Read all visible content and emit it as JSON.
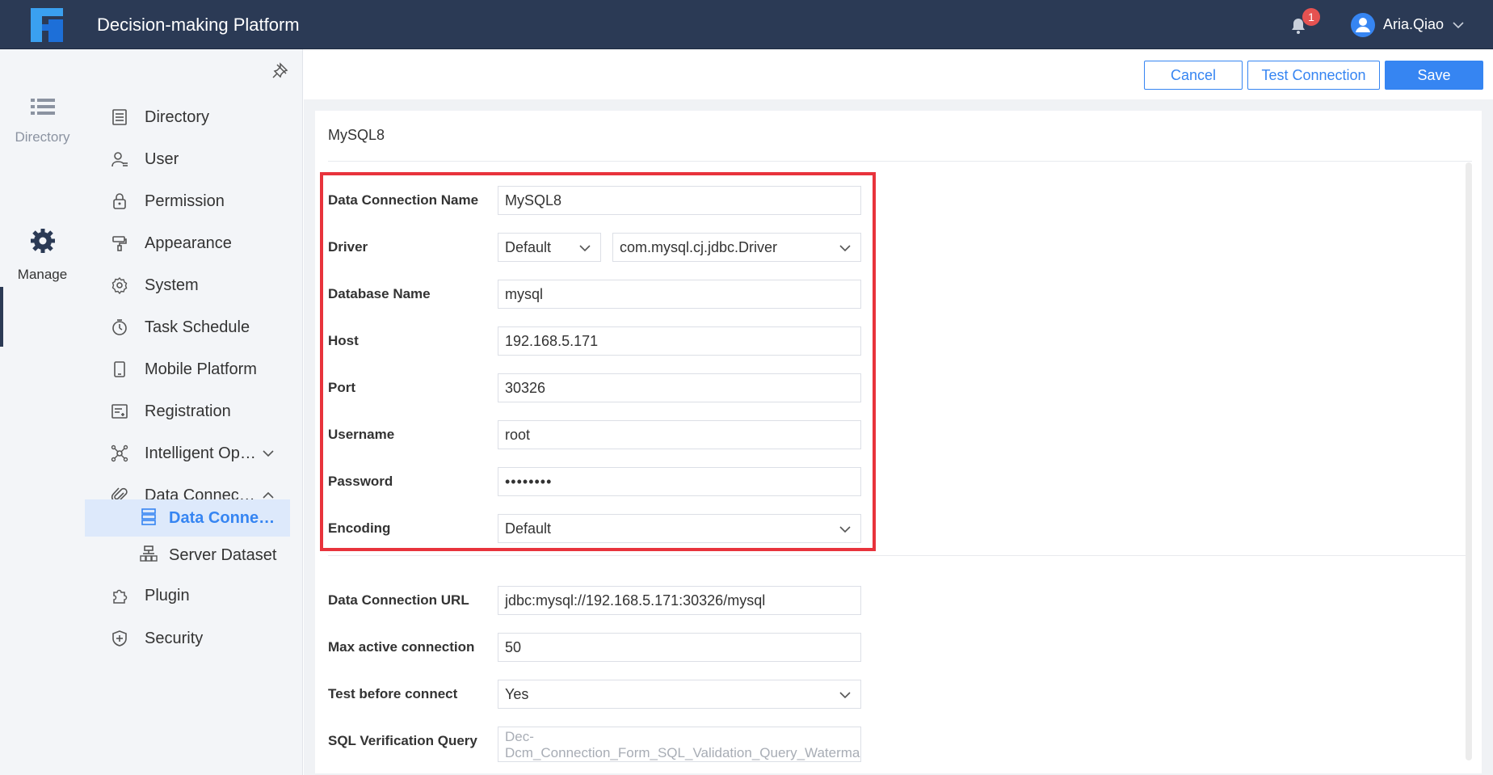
{
  "app": {
    "title": "Decision-making Platform",
    "notifications_count": "1",
    "user_name": "Aria.Qiao"
  },
  "rail": {
    "directory_label": "Directory",
    "manage_label": "Manage"
  },
  "nav": {
    "items": [
      {
        "label": "Directory"
      },
      {
        "label": "User"
      },
      {
        "label": "Permission"
      },
      {
        "label": "Appearance"
      },
      {
        "label": "System"
      },
      {
        "label": "Task Schedule"
      },
      {
        "label": "Mobile Platform"
      },
      {
        "label": "Registration"
      },
      {
        "label": "Intelligent Op…"
      },
      {
        "label": "Data Connec…"
      },
      {
        "label": "Plugin"
      },
      {
        "label": "Security"
      }
    ],
    "subitems": [
      {
        "label": "Data Conne…"
      },
      {
        "label": "Server Dataset"
      }
    ]
  },
  "actions": {
    "cancel": "Cancel",
    "test_connection": "Test Connection",
    "save": "Save"
  },
  "form": {
    "title": "MySQL8",
    "connection_name": {
      "label": "Data Connection Name",
      "value": "MySQL8"
    },
    "driver": {
      "label": "Driver",
      "type_value": "Default",
      "class_value": "com.mysql.cj.jdbc.Driver"
    },
    "database_name": {
      "label": "Database Name",
      "value": "mysql"
    },
    "host": {
      "label": "Host",
      "value": "192.168.5.171"
    },
    "port": {
      "label": "Port",
      "value": "30326"
    },
    "username": {
      "label": "Username",
      "value": "root"
    },
    "password": {
      "label": "Password",
      "value": "••••••••"
    },
    "encoding": {
      "label": "Encoding",
      "value": "Default"
    },
    "url": {
      "label": "Data Connection URL",
      "value": "jdbc:mysql://192.168.5.171:30326/mysql"
    },
    "max_active": {
      "label": "Max active connection",
      "value": "50"
    },
    "test_before_connect": {
      "label": "Test before connect",
      "value": "Yes"
    },
    "sql_verification": {
      "label": "SQL Verification Query",
      "placeholder": "Dec-Dcm_Connection_Form_SQL_Validation_Query_Watermark"
    }
  },
  "colors": {
    "topbar": "#2b3a55",
    "accent": "#3685f2",
    "highlight": "#e8333c",
    "badge": "#e65251"
  }
}
